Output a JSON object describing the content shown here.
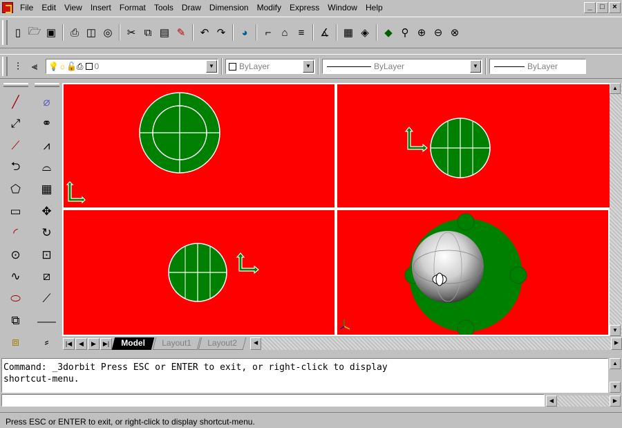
{
  "menubar": {
    "items": [
      {
        "label": "File"
      },
      {
        "label": "Edit"
      },
      {
        "label": "View"
      },
      {
        "label": "Insert"
      },
      {
        "label": "Format"
      },
      {
        "label": "Tools"
      },
      {
        "label": "Draw"
      },
      {
        "label": "Dimension"
      },
      {
        "label": "Modify"
      },
      {
        "label": "Express"
      },
      {
        "label": "Window"
      },
      {
        "label": "Help"
      }
    ],
    "win_controls": [
      "_",
      "□",
      "×"
    ]
  },
  "toolbar_std": {
    "icons": [
      "new-icon",
      "open-icon",
      "save-icon",
      "print-icon",
      "preview-icon",
      "spell-icon",
      "cut-icon",
      "copy-icon",
      "paste-icon",
      "matchprop-icon",
      "undo-icon",
      "redo-icon",
      "internet-icon",
      "snap-icon",
      "designcenter-icon",
      "properties-icon",
      "distance-icon",
      "namedviews-icon",
      "3dorbit-icon",
      "pan-icon",
      "zoom-icon",
      "zoomwindow-icon",
      "zoomprev-icon"
    ]
  },
  "toolbar_props": {
    "layer_value": "0",
    "color_value": "ByLayer",
    "linetype_value": "ByLayer",
    "lineweight_value": "ByLayer"
  },
  "viewports": {
    "colors": {
      "background": "#ff0000",
      "fill": "#008000",
      "outline": "#ffffff",
      "shaded": "#e0e0e0"
    }
  },
  "tabs": {
    "items": [
      {
        "label": "Model",
        "active": true
      },
      {
        "label": "Layout1",
        "active": false
      },
      {
        "label": "Layout2",
        "active": false
      }
    ]
  },
  "command": {
    "history": "Command: _3dorbit Press ESC or ENTER to exit, or right-click to display\nshortcut-menu.",
    "input": ""
  },
  "status": {
    "text": "Press ESC or ENTER to exit, or right-click to display shortcut-menu."
  }
}
